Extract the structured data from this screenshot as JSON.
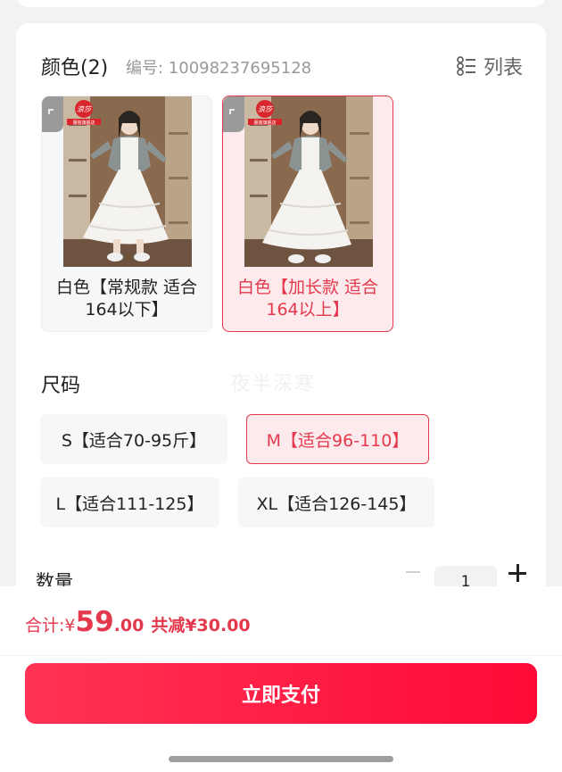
{
  "color_section": {
    "title": "颜色(2)",
    "sku_label": "编号: 10098237695128",
    "list_toggle_label": "列表"
  },
  "variants": [
    {
      "label": "白色【常规款 适合164以下】",
      "selected": false
    },
    {
      "label": "白色【加长款 适合164以上】",
      "selected": true
    }
  ],
  "shop_logo": {
    "text_top": "浪莎",
    "text_bottom": "服装旗舰店"
  },
  "watermark": "夜半深寒",
  "size_section": {
    "title": "尺码",
    "options": [
      {
        "label": "S【适合70-95斤】",
        "selected": false
      },
      {
        "label": "M【适合96-110】",
        "selected": true
      },
      {
        "label": "L【适合111-125】",
        "selected": false
      },
      {
        "label": "XL【适合126-145】",
        "selected": false
      }
    ]
  },
  "quantity": {
    "label": "数量",
    "value": "1"
  },
  "total": {
    "label": "合计: ",
    "currency": "¥",
    "integer": "59",
    "decimal": ".00",
    "saved": "共减¥30.00"
  },
  "pay_button_label": "立即支付",
  "colors": {
    "accent": "#e4394d",
    "pay_button": "#ff0a36",
    "selected_bg": "#fdeaed"
  },
  "icons": [
    "list-view-icon",
    "expand-icon",
    "minus-icon",
    "plus-icon"
  ]
}
